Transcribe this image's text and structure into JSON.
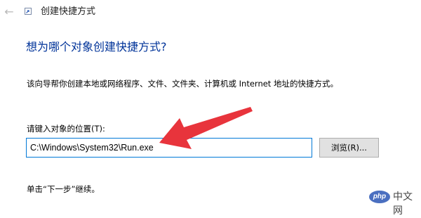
{
  "window": {
    "title": "创建快捷方式"
  },
  "wizard": {
    "heading": "想为哪个对象创建快捷方式?",
    "description": "该向导帮你创建本地或网络程序、文件、文件夹、计算机或 Internet 地址的快捷方式。",
    "location_label": "请键入对象的位置(T):",
    "location_value": "C:\\Windows\\System32\\Run.exe",
    "browse_label": "浏览(R)...",
    "hint": "单击“下一步”继续。"
  },
  "watermark": {
    "badge": "php",
    "text": "中文网"
  },
  "icons": {
    "back": "back-arrow-icon",
    "app": "shortcut-wizard-icon",
    "annotation": "red-arrow-annotation"
  },
  "colors": {
    "heading": "#003399",
    "input_focus_border": "#0078d7",
    "annotation_arrow": "#e8343c",
    "button_face": "#e1e1e1"
  }
}
